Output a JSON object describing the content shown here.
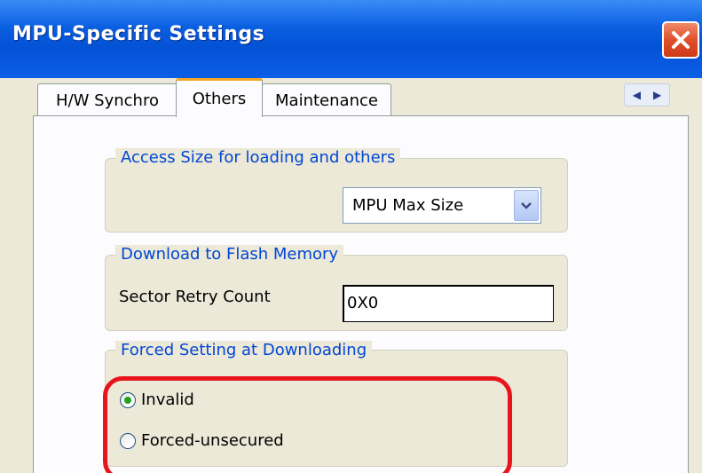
{
  "window": {
    "title": "MPU-Specific Settings"
  },
  "tabs": [
    {
      "label": "H/W Synchro"
    },
    {
      "label": "Others"
    },
    {
      "label": "Maintenance"
    }
  ],
  "groups": {
    "access_size": {
      "title": "Access Size for loading and others",
      "select_value": "MPU Max Size"
    },
    "flash": {
      "title": "Download to Flash Memory",
      "sector_retry_label": "Sector Retry Count",
      "sector_retry_value": "0X0"
    },
    "forced": {
      "title": "Forced Setting at Downloading",
      "options": [
        {
          "label": "Invalid",
          "checked": true
        },
        {
          "label": "Forced-unsecured",
          "checked": false
        }
      ]
    }
  },
  "colors": {
    "title_bar": "#0452d6",
    "group_title": "#0046d5",
    "highlight": "#e8141c",
    "radio_dot": "#21a121"
  }
}
